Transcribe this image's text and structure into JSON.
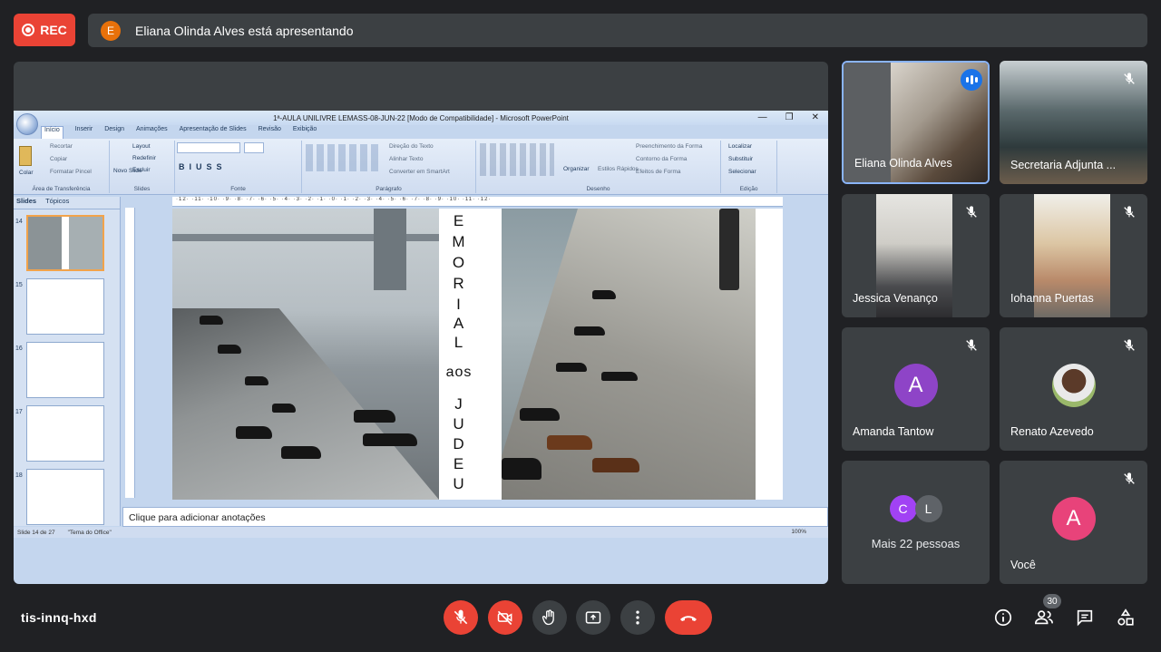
{
  "recording": {
    "label": "REC"
  },
  "presenter_bar": {
    "initial": "E",
    "text": "Eliana Olinda Alves está apresentando"
  },
  "powerpoint": {
    "title": "1ª-AULA UNILIVRE LEMASS-08-JUN-22 [Modo de Compatibilidade] - Microsoft PowerPoint",
    "tabs": [
      "Início",
      "Inserir",
      "Design",
      "Animações",
      "Apresentação de Slides",
      "Revisão",
      "Exibição"
    ],
    "ribbon": {
      "clipboard": {
        "label": "Área de Transferência",
        "paste": "Colar",
        "cut": "Recortar",
        "copy": "Copiar",
        "format_painter": "Formatar Pincel"
      },
      "slides": {
        "label": "Slides",
        "new_slide": "Novo Slide",
        "layout": "Layout",
        "reset": "Redefinir",
        "delete": "Excluir"
      },
      "font": {
        "label": "Fonte"
      },
      "paragraph": {
        "label": "Parágrafo",
        "text_direction": "Direção do Texto",
        "align_text": "Alinhar Texto",
        "smartart": "Converter em SmartArt"
      },
      "drawing": {
        "label": "Desenho",
        "arrange": "Organizar",
        "quick_styles": "Estilos Rápidos",
        "shape_fill": "Preenchimento da Forma",
        "shape_outline": "Contorno da Forma",
        "shape_effects": "Efeitos de Forma"
      },
      "editing": {
        "label": "Edição",
        "find": "Localizar",
        "replace": "Substituir",
        "select": "Selecionar"
      }
    },
    "pane_tabs": [
      "Slides",
      "Tópicos"
    ],
    "thumb_numbers": [
      "14",
      "15",
      "16",
      "17",
      "18"
    ],
    "ruler": "·12· ·11· ·10· ·9· ·8· ·7· ·6· ·5· ·4· ·3· ·2· ·1· ·0· ·1· ·2· ·3· ·4· ·5· ·6· ·7· ·8· ·9· ·10· ·11· ·12·",
    "slide_letters": [
      "E",
      "M",
      "O",
      "R",
      "I",
      "A",
      "L",
      "aos",
      "J",
      "U",
      "D",
      "E",
      "U"
    ],
    "notes_placeholder": "Clique para adicionar anotações",
    "status": {
      "slide": "Slide 14 de 27",
      "theme": "\"Tema do Office\"",
      "zoom": "100%"
    }
  },
  "participants": [
    {
      "name": "Eliana Olinda Alves"
    },
    {
      "name": "Secretaria Adjunta ..."
    },
    {
      "name": "Jessica Venanço"
    },
    {
      "name": "Iohanna Puertas"
    },
    {
      "name": "Amanda Tantow",
      "initial": "A",
      "color": "#8e44c7"
    },
    {
      "name": "Renato Azevedo"
    },
    {
      "name": "Mais 22 pessoas",
      "initials": [
        "C",
        "L"
      ],
      "colors": [
        "#a142f4",
        "#5f6368"
      ]
    },
    {
      "name": "Você",
      "initial": "A",
      "color": "#e8437a"
    }
  ],
  "bottom": {
    "meeting_code": "tis-innq-hxd",
    "participant_count": "30"
  }
}
